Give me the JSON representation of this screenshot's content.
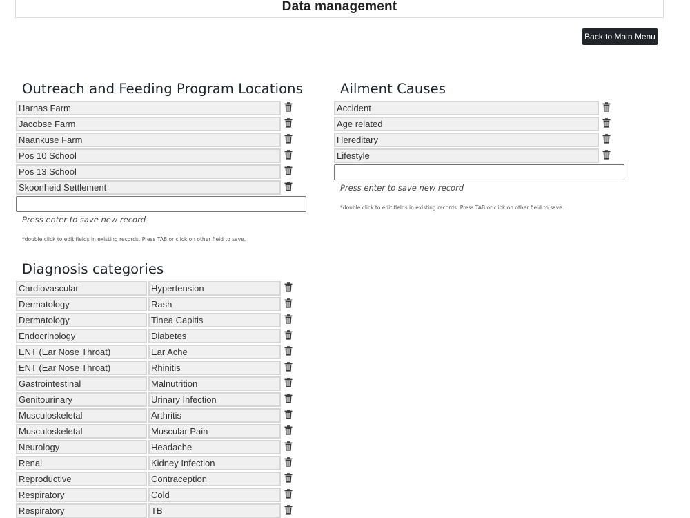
{
  "header": {
    "title": "Data management"
  },
  "back_button": {
    "label": "Back to Main Menu"
  },
  "locations": {
    "title": "Outreach and Feeding Program Locations",
    "items": [
      "Harnas Farm",
      "Jacobse Farm",
      "Naankuse Farm",
      "Pos 10 School",
      "Pos 13 School",
      "Skoonheid Settlement"
    ],
    "new_record_value": "",
    "hint": "Press enter to save new record",
    "note": "*double click to edit fields in existing records. Press TAB or click on other field to save."
  },
  "ailments": {
    "title": "Ailment Causes",
    "items": [
      "Accident",
      "Age related",
      "Hereditary",
      "Lifestyle"
    ],
    "new_record_value": "",
    "hint": "Press enter to save new record",
    "note": "*double click to edit fields in existing records. Press TAB or click on other field to save."
  },
  "diagnosis": {
    "title": "Diagnosis categories",
    "rows": [
      {
        "category": "Cardiovascular",
        "diagnosis": "Hypertension"
      },
      {
        "category": "Dermatology",
        "diagnosis": "Rash"
      },
      {
        "category": "Dermatology",
        "diagnosis": "Tinea Capitis"
      },
      {
        "category": "Endocrinology",
        "diagnosis": "Diabetes"
      },
      {
        "category": "ENT (Ear Nose Throat)",
        "diagnosis": "Ear Ache"
      },
      {
        "category": "ENT (Ear Nose Throat)",
        "diagnosis": "Rhinitis"
      },
      {
        "category": "Gastrointestinal",
        "diagnosis": "Malnutrition"
      },
      {
        "category": "Genitourinary",
        "diagnosis": "Urinary Infection"
      },
      {
        "category": "Musculoskeletal",
        "diagnosis": "Arthritis"
      },
      {
        "category": "Musculoskeletal",
        "diagnosis": "Muscular Pain"
      },
      {
        "category": "Neurology",
        "diagnosis": "Headache"
      },
      {
        "category": "Renal",
        "diagnosis": "Kidney Infection"
      },
      {
        "category": "Reproductive",
        "diagnosis": "Contraception"
      },
      {
        "category": "Respiratory",
        "diagnosis": "Cold"
      },
      {
        "category": "Respiratory",
        "diagnosis": "TB"
      }
    ]
  },
  "icons": {
    "delete": "trash-icon"
  }
}
